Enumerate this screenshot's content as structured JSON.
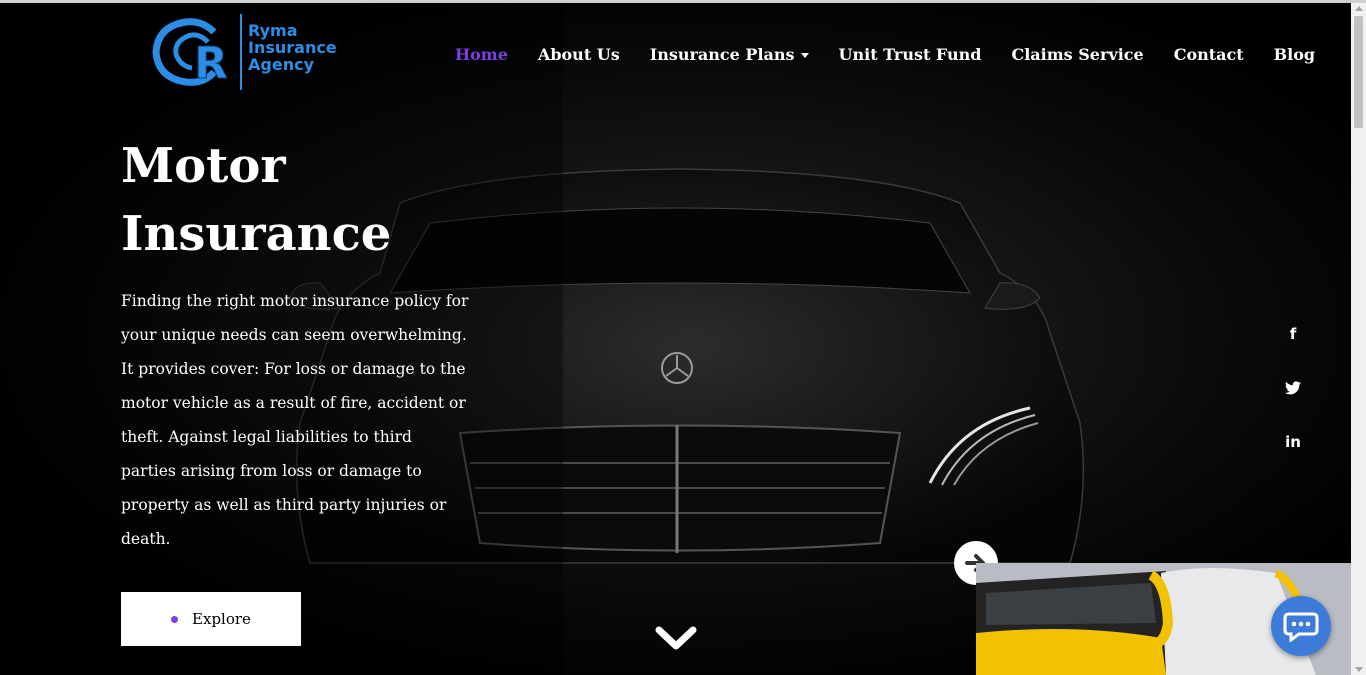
{
  "brand": {
    "logo_letters": "R",
    "name_line1": "Ryma",
    "name_line2": "Insurance",
    "name_line3": "Agency",
    "color": "#2b8de6"
  },
  "nav": {
    "items": [
      {
        "label": "Home",
        "active": true
      },
      {
        "label": "About Us",
        "active": false
      },
      {
        "label": "Insurance Plans",
        "active": false,
        "dropdown": true
      },
      {
        "label": "Unit Trust Fund",
        "active": false
      },
      {
        "label": "Claims Service",
        "active": false
      },
      {
        "label": "Contact",
        "active": false
      },
      {
        "label": "Blog",
        "active": false
      }
    ],
    "active_color": "#7b3fe4"
  },
  "hero": {
    "title_line1": "Motor",
    "title_line2": "Insurance",
    "description": "Finding the right motor insurance policy for your unique needs can seem overwhelming. It provides cover: For loss or damage to the motor vehicle as a result of fire, accident or theft. Against legal liabilities to third parties arising from loss or damage to property as well as third party injuries or death.",
    "button_label": "Explore"
  },
  "social": {
    "facebook": "f",
    "twitter": "twitter-icon",
    "linkedin": "in"
  },
  "icons": {
    "next": "arrow-right-icon",
    "scroll": "chevron-down-icon",
    "chat": "chat-bubble-icon"
  }
}
